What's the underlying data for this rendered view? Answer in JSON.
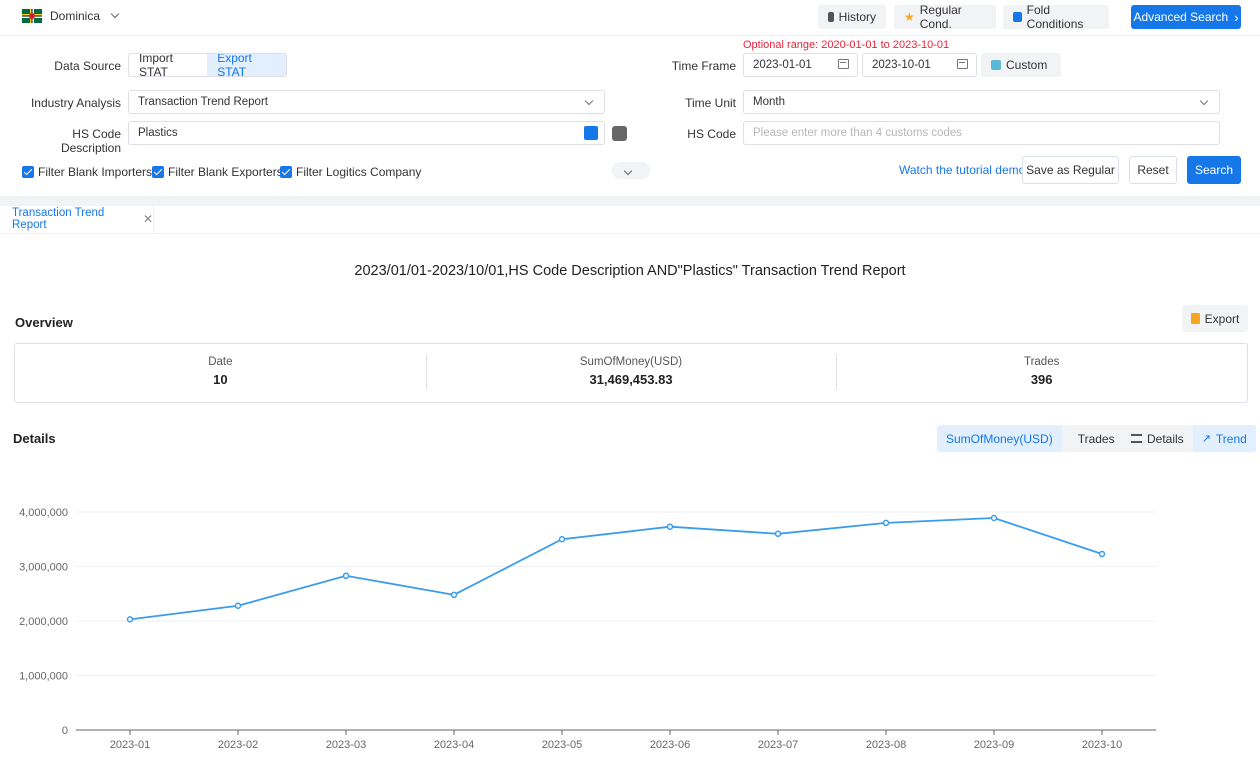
{
  "top": {
    "country": "Dominica",
    "history": "History",
    "regular": "Regular Cond.",
    "fold": "Fold Conditions",
    "advanced": "Advanced Search",
    "colors": {
      "accent": "#1677e8",
      "warning": "#e5243a"
    }
  },
  "filters": {
    "optional_range_label": "Optional range:",
    "optional_range": "2020-01-01 to 2023-10-01",
    "data_source_label": "Data Source",
    "import_stat": "Import STAT",
    "export_stat": "Export STAT",
    "time_frame_label": "Time Frame",
    "date_from": "2023-01-01",
    "date_to": "2023-10-01",
    "custom": "Custom",
    "industry_label": "Industry Analysis",
    "industry_value": "Transaction Trend Report",
    "time_unit_label": "Time Unit",
    "time_unit_value": "Month",
    "hs_desc_label": "HS Code Description",
    "hs_desc_value": "Plastics",
    "hs_code_label": "HS Code",
    "hs_code_placeholder": "Please enter more than 4 customs codes",
    "cb_importers": "Filter Blank Importers",
    "cb_exporters": "Filter Blank Exporters",
    "cb_logistics": "Filter Logitics Company",
    "tutorial": "Watch the tutorial demo",
    "save_regular": "Save as Regular",
    "reset": "Reset",
    "search": "Search"
  },
  "report": {
    "tab": "Transaction Trend Report",
    "title": "2023/01/01-2023/10/01,HS Code Description AND\"Plastics\" Transaction Trend Report",
    "overview": "Overview",
    "export": "Export",
    "stats": [
      {
        "label": "Date",
        "value": "10"
      },
      {
        "label": "SumOfMoney(USD)",
        "value": "31,469,453.83"
      },
      {
        "label": "Trades",
        "value": "396"
      }
    ],
    "details": "Details",
    "metric_sum": "SumOfMoney(USD)",
    "metric_trades": "Trades",
    "view_details": "Details",
    "view_trend": "Trend"
  },
  "chart_data": {
    "type": "line",
    "x": [
      "2023-01",
      "2023-02",
      "2023-03",
      "2023-04",
      "2023-05",
      "2023-06",
      "2023-07",
      "2023-08",
      "2023-09",
      "2023-10"
    ],
    "series": [
      {
        "values": [
          2030000,
          2280000,
          2830000,
          2480000,
          3500000,
          3730000,
          3600000,
          3800000,
          3890000,
          3230000
        ]
      }
    ],
    "yticks": [
      "0",
      "1,000,000",
      "2,000,000",
      "3,000,000",
      "4,000,000"
    ],
    "ylim": [
      0,
      4000000
    ],
    "grid": true,
    "color": "#3a9cea"
  }
}
